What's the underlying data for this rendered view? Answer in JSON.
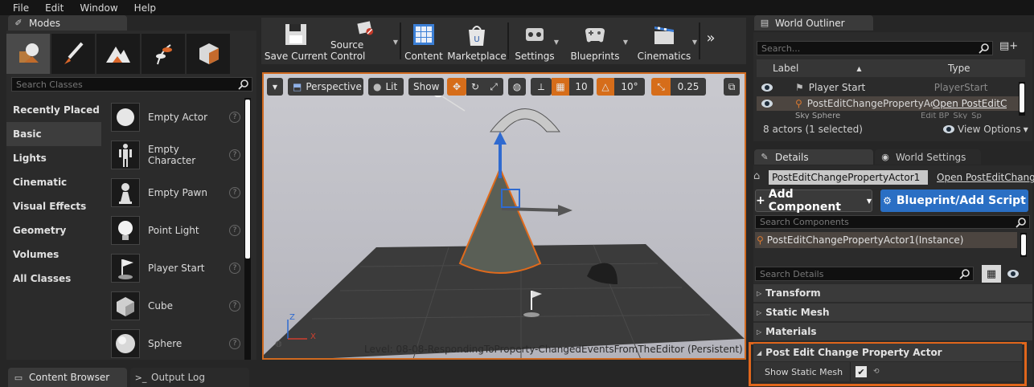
{
  "menu": [
    "File",
    "Edit",
    "Window",
    "Help"
  ],
  "tabs": {
    "modes": "Modes",
    "world_outliner": "World Outliner",
    "details": "Details",
    "world_settings": "World Settings",
    "content_browser": "Content Browser",
    "output_log": "Output Log"
  },
  "modes": {
    "search_placeholder": "Search Classes",
    "categories": [
      "Recently Placed",
      "Basic",
      "Lights",
      "Cinematic",
      "Visual Effects",
      "Geometry",
      "Volumes",
      "All Classes"
    ],
    "selected_category": "Basic",
    "items": [
      "Empty Actor",
      "Empty Character",
      "Empty Pawn",
      "Point Light",
      "Player Start",
      "Cube",
      "Sphere"
    ]
  },
  "toolbar": {
    "buttons": [
      "Save Current",
      "Source Control",
      "Content",
      "Marketplace",
      "Settings",
      "Blueprints",
      "Cinematics"
    ],
    "more": "»"
  },
  "viewport": {
    "perspective": "Perspective",
    "lit": "Lit",
    "show": "Show",
    "grid_snap": "10",
    "rot_snap": "10°",
    "scale_snap": "0.25",
    "level": "Level:  08-08-RespondingToProperty-ChangedEventsFromTheEditor (Persistent)",
    "axis_z": "Z",
    "axis_x": "X"
  },
  "outliner": {
    "search_placeholder": "Search...",
    "col_label": "Label",
    "col_type": "Type",
    "rows": [
      {
        "label": "Player Start",
        "type": "PlayerStart"
      },
      {
        "label": "PostEditChangePropertyActor",
        "type": "Open PostEditC"
      },
      {
        "label": "Sky Sphere",
        "type": "Edit BP_Sky_Sp"
      }
    ],
    "count": "8 actors (1 selected)",
    "view_options": "View Options"
  },
  "details": {
    "actor_name": "PostEditChangePropertyActor1",
    "open_link": "Open PostEditChange",
    "add_component": "Add Component",
    "blueprint_script": "Blueprint/Add Script",
    "search_components": "Search Components",
    "instance": "PostEditChangePropertyActor1(Instance)",
    "search_details": "Search Details",
    "categories": [
      "Transform",
      "Static Mesh",
      "Materials"
    ],
    "highlight_category": "Post Edit Change Property Actor",
    "property_label": "Show Static Mesh",
    "property_checked": true
  },
  "colors": {
    "accent_orange": "#e0661c",
    "blue_button": "#2a6fc4",
    "selected_row": "#4c4540"
  }
}
